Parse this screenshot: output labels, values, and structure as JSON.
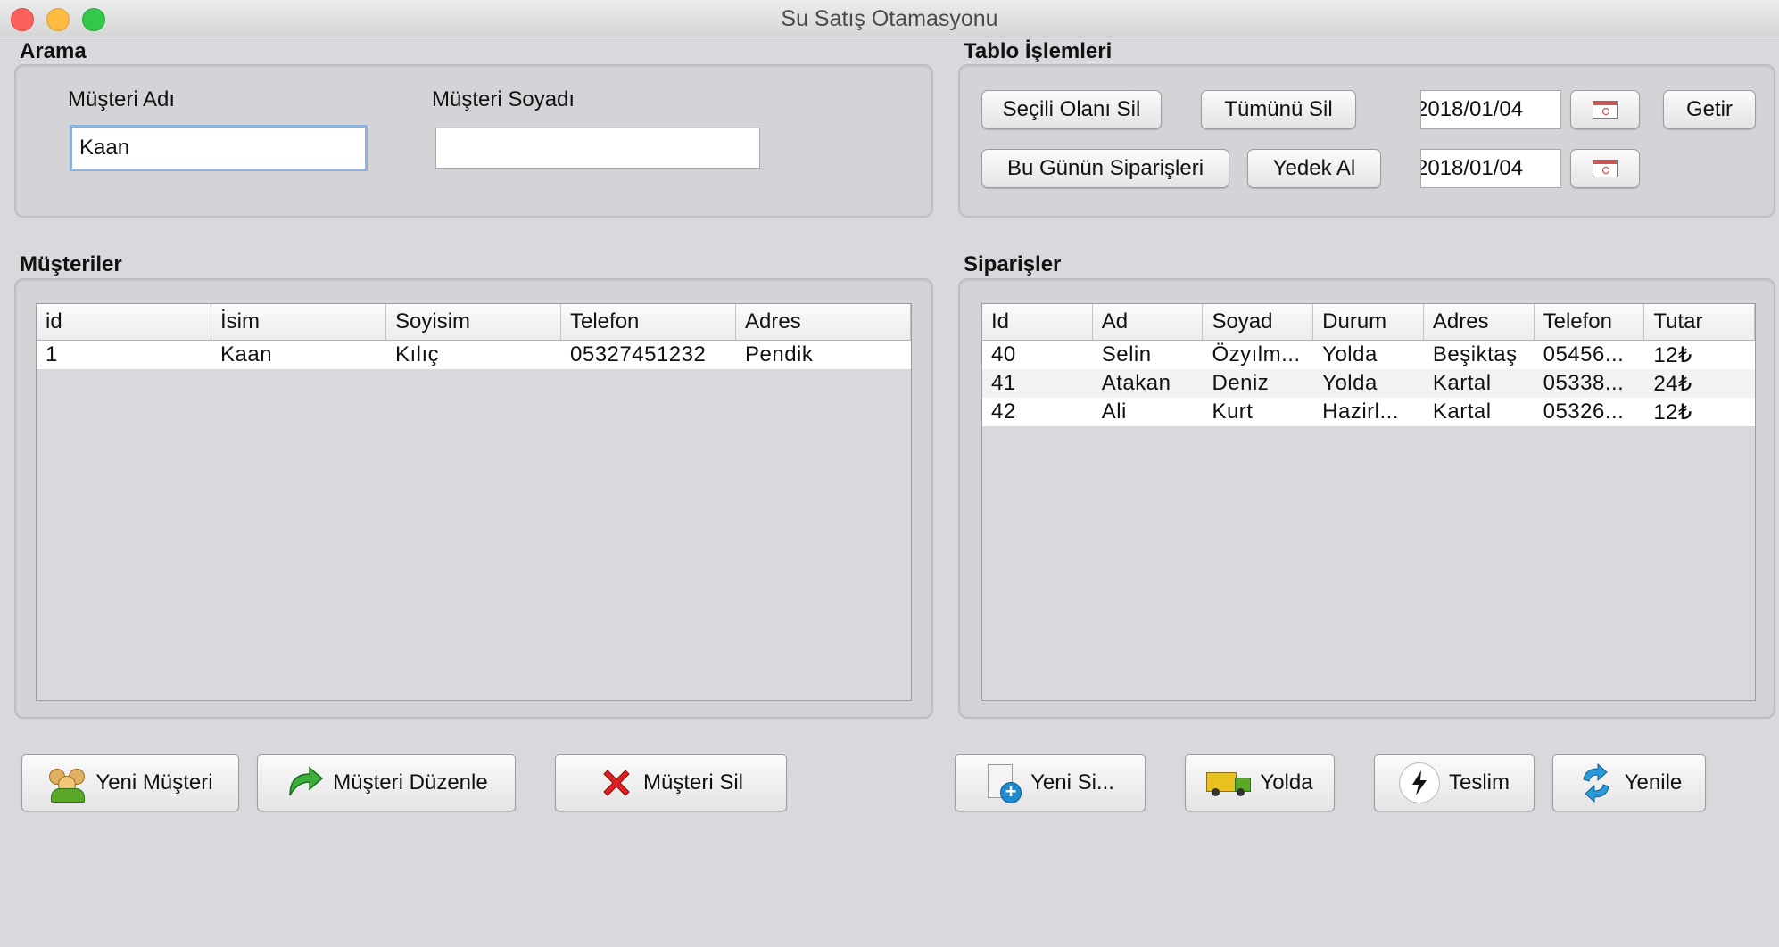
{
  "window": {
    "title": "Su Satış Otamasyonu"
  },
  "search": {
    "legend": "Arama",
    "first_name_label": "Müşteri Adı",
    "first_name_value": "Kaan",
    "last_name_label": "Müşteri Soyadı",
    "last_name_value": ""
  },
  "table_ops": {
    "legend": "Tablo İşlemleri",
    "delete_selected": "Seçili Olanı Sil",
    "delete_all": "Tümünü Sil",
    "todays_orders": "Bu Günün Siparişleri",
    "backup": "Yedek Al",
    "date_from": "2018/01/04",
    "date_to": "2018/01/04",
    "fetch": "Getir"
  },
  "customers": {
    "legend": "Müşteriler",
    "columns": [
      "id",
      "İsim",
      "Soyisim",
      "Telefon",
      "Adres"
    ],
    "rows": [
      [
        "1",
        "Kaan",
        "Kılıç",
        "05327451232",
        "Pendik"
      ]
    ]
  },
  "orders": {
    "legend": "Siparişler",
    "columns": [
      "Id",
      "Ad",
      "Soyad",
      "Durum",
      "Adres",
      "Telefon",
      "Tutar"
    ],
    "rows": [
      [
        "40",
        "Selin",
        "Özyılm...",
        "Yolda",
        "Beşiktaş",
        "05456...",
        "12₺"
      ],
      [
        "41",
        "Atakan",
        "Deniz",
        "Yolda",
        "Kartal",
        "05338...",
        "24₺"
      ],
      [
        "42",
        "Ali",
        "Kurt",
        "Hazirl...",
        "Kartal",
        "05326...",
        "12₺"
      ]
    ]
  },
  "actions": {
    "new_customer": "Yeni Müşteri",
    "edit_customer": "Müşteri Düzenle",
    "delete_customer": "Müşteri Sil",
    "new_order": "Yeni Si...",
    "on_the_way": "Yolda",
    "delivered": "Teslim",
    "refresh": "Yenile"
  },
  "colors": {
    "background": "#d8d8dd",
    "focus_ring": "#8fb3df",
    "delete_red": "#e02020",
    "refresh_blue": "#2a9ad8",
    "truck_green": "#5aa828"
  }
}
